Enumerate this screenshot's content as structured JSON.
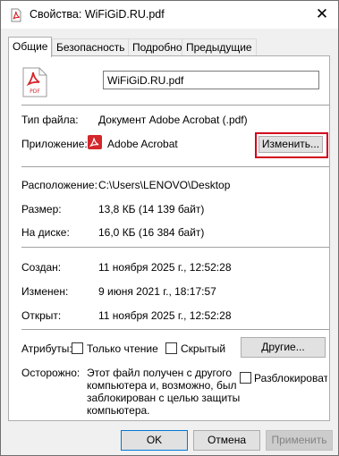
{
  "window": {
    "title": "Свойства: WiFiGiD.RU.pdf"
  },
  "tabs": [
    "Общие",
    "Безопасность",
    "Подробно",
    "Предыдущие версии"
  ],
  "file": {
    "name": "WiFiGiD.RU.pdf",
    "icon_label": "PDF"
  },
  "type": {
    "label": "Тип файла:",
    "value": "Документ Adobe Acrobat (.pdf)"
  },
  "app": {
    "label": "Приложение:",
    "value": "Adobe Acrobat",
    "change_button": "Изменить..."
  },
  "location": {
    "label": "Расположение:",
    "value": "C:\\Users\\LENOVO\\Desktop"
  },
  "size": {
    "label": "Размер:",
    "value": "13,8 КБ (14 139 байт)"
  },
  "disk": {
    "label": "На диске:",
    "value": "16,0 КБ (16 384 байт)"
  },
  "created": {
    "label": "Создан:",
    "value": "11 ноября 2025 г., 12:52:28"
  },
  "modified": {
    "label": "Изменен:",
    "value": "9 июня 2021 г., 18:17:57"
  },
  "opened": {
    "label": "Открыт:",
    "value": "11 ноября 2025 г., 12:52:28"
  },
  "attributes": {
    "label": "Атрибуты:",
    "readonly": "Только чтение",
    "hidden": "Скрытый",
    "other_button": "Другие..."
  },
  "caution": {
    "label": "Осторожно:",
    "text_lines": [
      "Этот файл получен с другого",
      "компьютера и, возможно, был",
      "заблокирован с целью защиты",
      "компьютера."
    ],
    "unblock": "Разблокировать"
  },
  "footer": {
    "ok": "OK",
    "cancel": "Отмена",
    "apply": "Применить"
  },
  "colors": {
    "pdf_red": "#d4262b",
    "highlight": "#d0021b",
    "accent": "#0078d7"
  }
}
